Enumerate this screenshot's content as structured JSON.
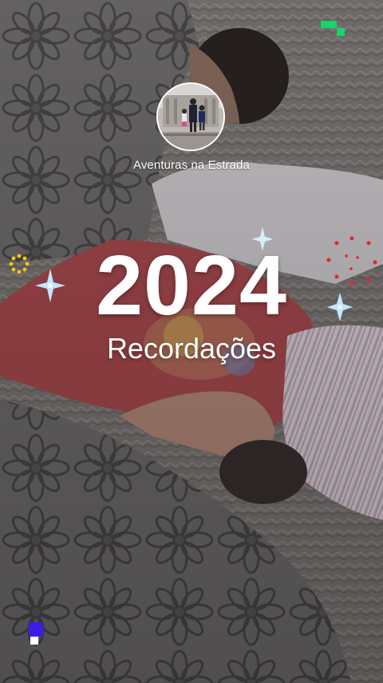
{
  "album": {
    "name": "Aventuras na Estrada"
  },
  "memory": {
    "year": "2024",
    "title": "Recordações"
  },
  "colors": {
    "accent_green": "#19d36b",
    "accent_blue": "#3b1ee6",
    "sparkle": "#bfe6ff",
    "firework_red": "#e5242b",
    "firework_yellow": "#f3c515"
  },
  "icons": {
    "avatar": "album-cover-photo",
    "sparkles": "sparkle-icon",
    "firework": "firework-icon"
  }
}
